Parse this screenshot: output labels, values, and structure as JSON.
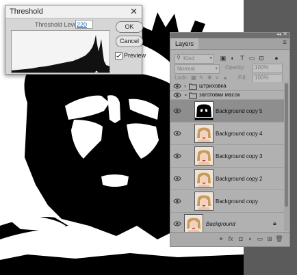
{
  "threshold_dialog": {
    "title": "Threshold",
    "level_label": "Threshold Level:",
    "level_value": "220",
    "ok_label": "OK",
    "cancel_label": "Cancel",
    "preview_label": "Preview",
    "preview_checked": true
  },
  "layers_panel": {
    "tab_label": "Layers",
    "filter_kind": "Kind",
    "blend_mode": "Normal",
    "opacity_label": "Opacity:",
    "opacity_value": "100%",
    "lock_label": "Lock:",
    "fill_label": "Fill:",
    "fill_value": "100%",
    "layers": [
      {
        "name": "штриховка",
        "kind": "group",
        "visible": true,
        "expanded": false
      },
      {
        "name": "заготовки масок",
        "kind": "group",
        "visible": true,
        "expanded": true
      },
      {
        "name": "Background copy 5",
        "kind": "layer",
        "thumb": "threshold",
        "visible": true,
        "selected": true
      },
      {
        "name": "Background copy 4",
        "kind": "layer",
        "thumb": "photo",
        "visible": true
      },
      {
        "name": "Background copy 3",
        "kind": "layer",
        "thumb": "photo",
        "visible": true
      },
      {
        "name": "Background copy 2",
        "kind": "layer",
        "thumb": "photo",
        "visible": true
      },
      {
        "name": "Background copy",
        "kind": "layer",
        "thumb": "photo",
        "visible": true
      },
      {
        "name": "Background",
        "kind": "background",
        "thumb": "photo",
        "visible": true,
        "locked": true
      }
    ]
  },
  "icons": {
    "close": "close-icon",
    "panel_menu": "hamburger-icon",
    "eye": "eye-icon",
    "folder": "folder-icon",
    "lock": "lock-icon",
    "footer": [
      "link-icon",
      "fx-icon",
      "mask-icon",
      "adjustment-icon",
      "folder-icon",
      "new-layer-icon",
      "trash-icon"
    ]
  },
  "colors": {
    "panel_bg": "#b1b1b1",
    "selected_row": "#8e8e8e",
    "dialog_bg": "#d6d6d6",
    "workspace": "#5a5a5a",
    "level_text": "#1565c0"
  }
}
